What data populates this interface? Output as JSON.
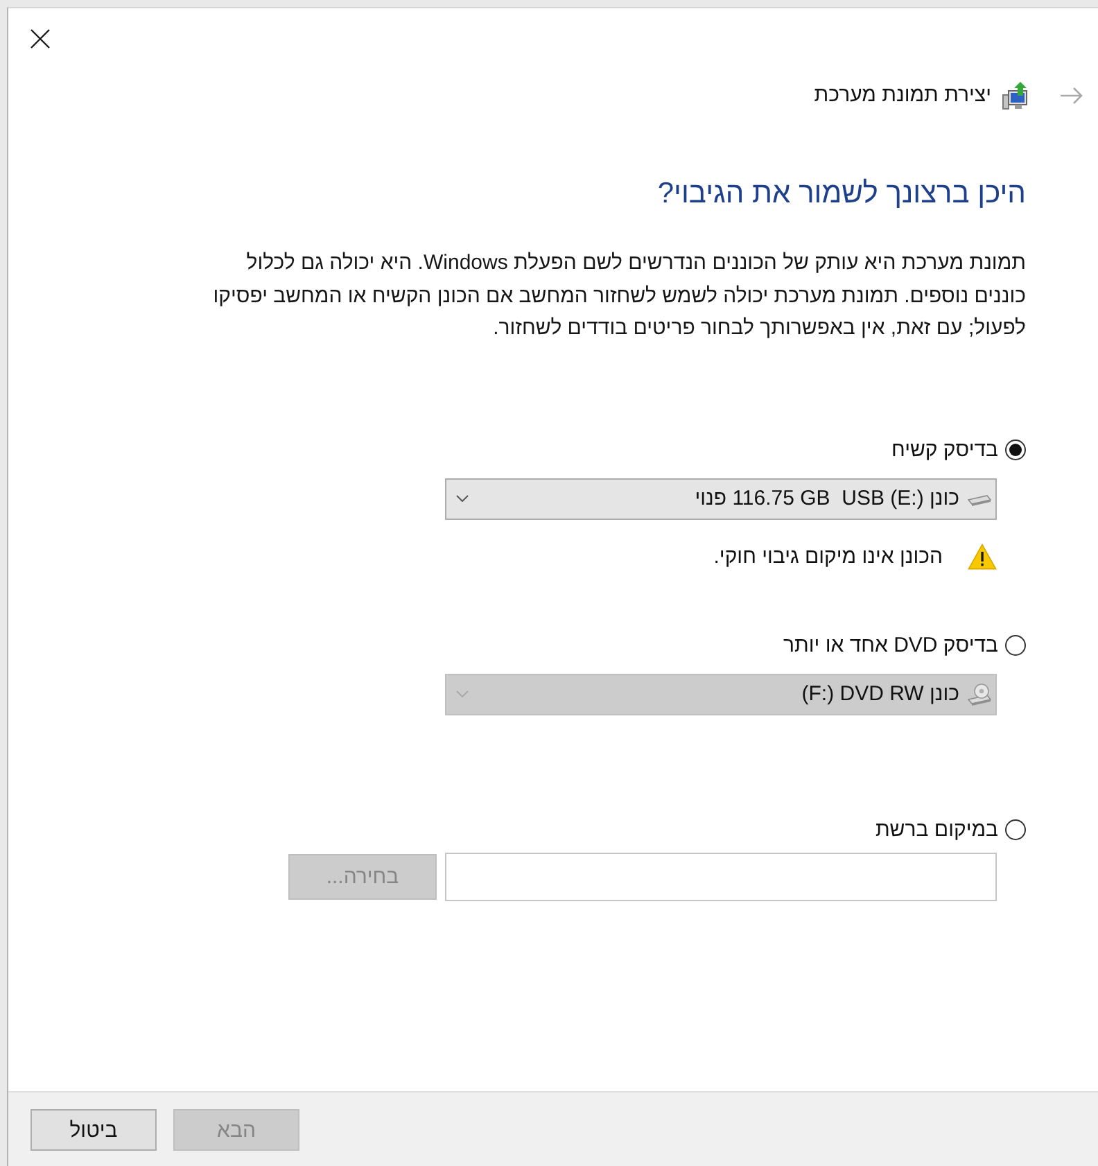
{
  "header": {
    "back_button": {
      "disabled": true
    },
    "title": "יצירת תמונת מערכת"
  },
  "heading": "היכן ברצונך לשמור את הגיבוי?",
  "description": "תמונת מערכת היא עותק של הכוננים הנדרשים לשם הפעלת Windows. היא יכולה גם לכלול כוננים נוספים. תמונת מערכת יכולה לשמש לשחזור המחשב אם הכונן הקשיח או המחשב יפסיקו לפעול; עם זאת, אין באפשרותך לבחור פריטים בודדים לשחזור.",
  "options": [
    {
      "kind": "hard_disk",
      "label": "בדיסק קשיח",
      "selected": true,
      "dropdown": {
        "value": "כונן ‎(E:)‏ USB ‏ ‎116.75 GB פנוי",
        "disabled": false
      },
      "warning": "הכונן אינו מיקום גיבוי חוקי."
    },
    {
      "kind": "dvd",
      "label": "בדיסק DVD אחד או יותר",
      "selected": false,
      "dropdown": {
        "value": "כונן DVD RW‏ ‎(F:)",
        "disabled": true
      }
    },
    {
      "kind": "network",
      "label": "במיקום ברשת",
      "selected": false,
      "browse_button": {
        "label": "בחירה...",
        "disabled": true
      }
    }
  ],
  "buttons": [
    {
      "label": "הבא",
      "disabled": true
    },
    {
      "label": "ביטול",
      "disabled": false
    }
  ]
}
